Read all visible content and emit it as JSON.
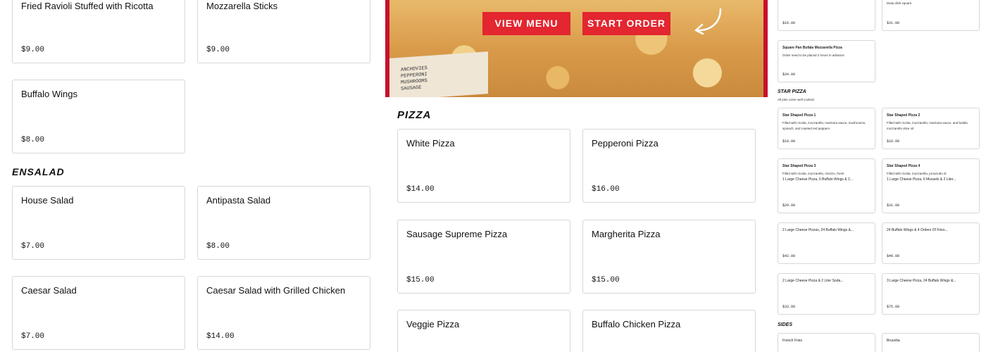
{
  "appetizers": [
    {
      "name": "Fried Ravioli Stuffed with Ricotta",
      "price": "$9.00"
    },
    {
      "name": "Mozzarella Sticks",
      "price": "$9.00"
    },
    {
      "name": "Buffalo Wings",
      "price": "$8.00"
    }
  ],
  "ensalad": {
    "title": "ENSALAD",
    "items": [
      {
        "name": "House Salad",
        "price": "$7.00"
      },
      {
        "name": "Antipasta Salad",
        "price": "$8.00"
      },
      {
        "name": "Caesar Salad",
        "price": "$7.00"
      },
      {
        "name": "Caesar Salad with Grilled Chicken",
        "price": "$14.00"
      }
    ]
  },
  "hero": {
    "view_menu": "VIEW MENU",
    "start_order": "START ORDER",
    "box_text": "ANCHOVIES\nPEPPERONI\nMUSHROOMS\nSAUSAGE",
    "brand_color": "#c8102e",
    "button_color": "#e3262f",
    "arrow_icon": "curved-arrow"
  },
  "pizza": {
    "title": "PIZZA",
    "items": [
      {
        "name": "White Pizza",
        "price": "$14.00"
      },
      {
        "name": "Pepperoni Pizza",
        "price": "$16.00"
      },
      {
        "name": "Sausage Supreme Pizza",
        "price": "$15.00"
      },
      {
        "name": "Margherita Pizza",
        "price": "$15.00"
      },
      {
        "name": "Veggie Pizza",
        "price": ""
      },
      {
        "name": "Buffalo Chicken Pizza",
        "price": ""
      }
    ]
  },
  "right": {
    "top_cards": [
      {
        "title": "",
        "desc": "",
        "price": "$16.00"
      },
      {
        "title": "",
        "desc": "Deep dish square.",
        "price": "$31.00"
      },
      {
        "title": "Square Pan Bufala Mozzarella Pizza",
        "desc": "Order need to be placed 2 hours in advance.",
        "price": "$34.00"
      }
    ],
    "star_pizza": {
      "title": "STAR PIZZA",
      "subtitle": "All pies come well cooked.",
      "items": [
        {
          "title": "Star Shaped Pizza 1",
          "desc": "Filled with ricotta, mozzarella, marinara sauce, mushrooms, spinach, and roasted red peppers.",
          "price": "$19.00"
        },
        {
          "title": "Star Shaped Pizza 2",
          "desc": "Filled with ricotta, mozzarella, marinara sauce, and bufala mozzarella olive oil.",
          "price": "$18.00"
        },
        {
          "title": "Star Shaped Pizza 3",
          "desc": "Filled with ricotta, mozzarella, chorizo, fresh",
          "price": ""
        },
        {
          "title": "Star Shaped Pizza 4",
          "desc": "Filled with ricotta, mozzarella, prosciutto di",
          "price": ""
        }
      ]
    },
    "specials": [
      {
        "title": "1 Large Cheese Pizza, 6 Buffalo Wings & 2...",
        "price": "$29.00"
      },
      {
        "title": "1 Large Cheese Pizza, 6 Mussels & 2 Liter...",
        "price": "$31.00"
      },
      {
        "title": "2 Large Cheese Pizzas, 24 Buffalo Wings &...",
        "price": "$42.00"
      },
      {
        "title": "24 Buffalo Wings & 4 Orders Of Fries...",
        "price": "$40.00"
      },
      {
        "title": "2 Large Cheese Pizza & 2 Liter Soda...",
        "price": "$33.00"
      },
      {
        "title": "3 Large Cheese Pizza, 24 Buffalo Wings &...",
        "price": "$75.00"
      }
    ],
    "sides": {
      "title": "SIDES",
      "items": [
        {
          "title": "French Fries"
        },
        {
          "title": "Brucetta"
        }
      ]
    }
  }
}
